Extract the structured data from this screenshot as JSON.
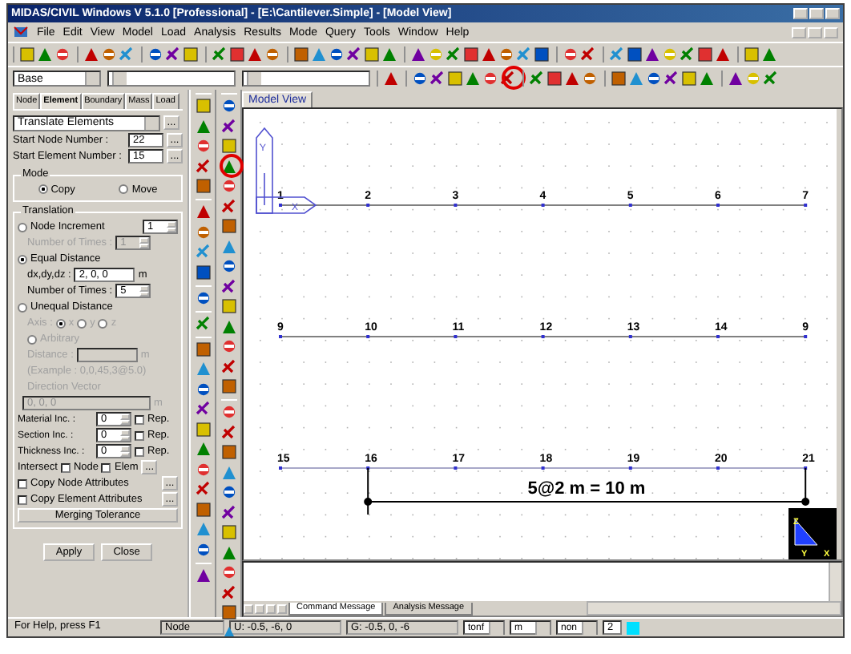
{
  "window": {
    "title": "MIDAS/CIVIL Windows V 5.1.0 [Professional] - [E:\\Cantilever.Simple] - [Model View]"
  },
  "menu": [
    "File",
    "Edit",
    "View",
    "Model",
    "Load",
    "Analysis",
    "Results",
    "Mode",
    "Query",
    "Tools",
    "Window",
    "Help"
  ],
  "toolbar": {
    "view_combo": "Base"
  },
  "left_panel": {
    "tabs": [
      {
        "label": "Node",
        "selected": false
      },
      {
        "label": "Element",
        "selected": true
      },
      {
        "label": "Boundary",
        "selected": false
      },
      {
        "label": "Mass",
        "selected": false
      },
      {
        "label": "Load",
        "selected": false
      }
    ],
    "command": "Translate Elements",
    "more_button": "...",
    "start_fields": [
      {
        "label": "Start Node Number :",
        "value": "22"
      },
      {
        "label": "Start Element Number :",
        "value": "15"
      }
    ],
    "mode": {
      "title": "Mode",
      "options": [
        {
          "label": "Copy",
          "selected": true
        },
        {
          "label": "Move",
          "selected": false
        }
      ]
    },
    "translation": {
      "title": "Translation",
      "rows": [
        {
          "kind": "radio",
          "label": "Node Increment",
          "selected": false,
          "disabled": false,
          "value": "1"
        },
        {
          "kind": "spin",
          "label": "Number of Times :",
          "value": "1",
          "disabled": true
        },
        {
          "kind": "radio",
          "label": "Equal Distance",
          "selected": true,
          "disabled": false
        },
        {
          "kind": "field",
          "label": "dx,dy,dz :",
          "value": "2, 0, 0",
          "unit": "m",
          "disabled": false
        },
        {
          "kind": "spin",
          "label": "Number of Times :",
          "value": "5",
          "disabled": false
        },
        {
          "kind": "radio",
          "label": "Unequal Distance",
          "selected": false,
          "disabled": false
        },
        {
          "kind": "axis",
          "label": "Axis :",
          "disabled": true,
          "options": [
            {
              "label": "x",
              "selected": true
            },
            {
              "label": "y",
              "selected": false
            },
            {
              "label": "z",
              "selected": false
            }
          ]
        },
        {
          "kind": "option",
          "label": "Arbitrary",
          "selected": false,
          "disabled": true
        },
        {
          "kind": "field",
          "label": "Distance :",
          "unit": "m",
          "disabled": true
        },
        {
          "kind": "note",
          "text": "(Example : 0,0,45,3@5.0)",
          "disabled": true
        },
        {
          "kind": "note",
          "text": "Direction Vector",
          "disabled": true
        },
        {
          "kind": "wide",
          "value": "0, 0, 0",
          "unit": "m",
          "disabled": true
        },
        {
          "kind": "inc",
          "label": "Material Inc. :",
          "value": "0",
          "rep": "Rep.",
          "checked": false
        },
        {
          "kind": "inc",
          "label": "Section Inc. :",
          "value": "0",
          "rep": "Rep.",
          "checked": false
        },
        {
          "kind": "inc",
          "label": "Thickness Inc. :",
          "value": "0",
          "rep": "Rep.",
          "checked": false
        },
        {
          "kind": "intersect",
          "label": "Intersect",
          "options": [
            {
              "label": "Node",
              "checked": false
            },
            {
              "label": "Elem",
              "checked": false
            }
          ]
        },
        {
          "kind": "check",
          "label": "Copy Node Attributes",
          "checked": false
        },
        {
          "kind": "check",
          "label": "Copy Element Attributes",
          "checked": false
        },
        {
          "kind": "button",
          "label": "Merging Tolerance"
        }
      ]
    },
    "buttons": [
      "Apply",
      "Close"
    ]
  },
  "model_view": {
    "tab": "Model View",
    "rows": [
      [
        "1",
        "2",
        "3",
        "4",
        "5",
        "6",
        "7"
      ],
      [
        "9",
        "10",
        "11",
        "12",
        "13",
        "14",
        "9"
      ],
      [
        "15",
        "16",
        "17",
        "18",
        "19",
        "20",
        "21"
      ]
    ],
    "global_axis": {
      "x_label": "X",
      "y_label": "Y"
    },
    "dimension": "5@2 m = 10 m",
    "view_axis": [
      "Z",
      "Y",
      "X"
    ]
  },
  "messages": {
    "tabs": [
      {
        "label": "Command Message",
        "selected": true
      },
      {
        "label": "Analysis Message",
        "selected": false
      }
    ]
  },
  "status_bar": {
    "help": "For Help, press F1",
    "mode": "Node",
    "local": "U: -0.5, -6, 0",
    "global": "G: -0.5, 0, -6",
    "force_unit": "tonf",
    "length_unit": "m",
    "combo": "non",
    "value": "2"
  }
}
